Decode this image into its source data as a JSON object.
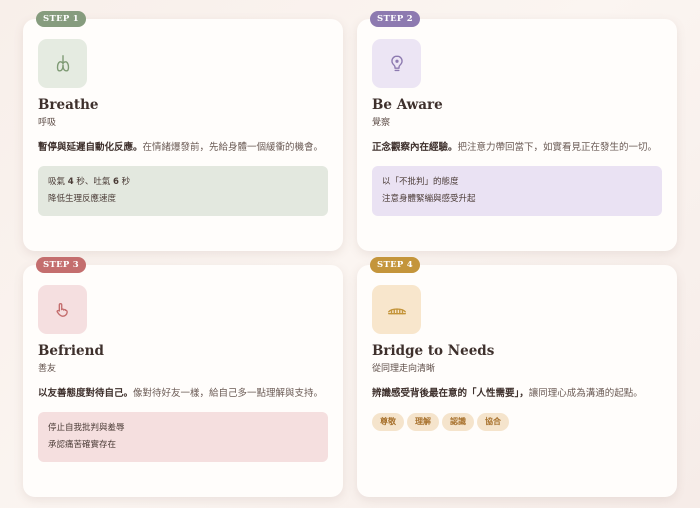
{
  "colors": {
    "step1": "#869c7e",
    "step2": "#8d7ab0",
    "step3": "#c46e6e",
    "step4": "#c4953b",
    "icon1_bg": "#e5ebe1",
    "icon2_bg": "#ece5f4",
    "icon3_bg": "#f5dfe0",
    "icon4_bg": "#f8e6cc",
    "note1_bg": "#e3e8df",
    "note2_bg": "#eae2f3",
    "note3_bg": "#f5dfdf"
  },
  "cards": [
    {
      "step": "STEP 1",
      "icon": "lungs-icon",
      "title": "Breathe",
      "subtitle": "呼吸",
      "desc_strong": "暫停與延遲自動化反應。",
      "desc_rest": "在情緒爆發前，先給身體一個緩衝的機會。",
      "note_line1_a": "吸氣 ",
      "note_line1_b": "4",
      "note_line1_c": " 秒、吐氣 ",
      "note_line1_d": "6",
      "note_line1_e": " 秒",
      "note_line2": "降低生理反應速度"
    },
    {
      "step": "STEP 2",
      "icon": "lightbulb-icon",
      "title": "Be Aware",
      "subtitle": "覺察",
      "desc_strong": "正念觀察內在經驗。",
      "desc_rest": "把注意力帶回當下，如實看見正在發生的一切。",
      "note_line1": "以「不批判」的態度",
      "note_line2": "注意身體緊繃與感受升起"
    },
    {
      "step": "STEP 3",
      "icon": "hand-heart-icon",
      "title": "Befriend",
      "subtitle": "善友",
      "desc_strong": "以友善態度對待自己。",
      "desc_rest": "像對待好友一樣，給自己多一點理解與支持。",
      "note_line1": "停止自我批判與羞辱",
      "note_line2": "承認痛苦確實存在"
    },
    {
      "step": "STEP 4",
      "icon": "bridge-icon",
      "title": "Bridge to Needs",
      "subtitle": "從同理走向清晰",
      "desc_strong": "辨識感受背後最在意的「人性需要」，",
      "desc_rest": "讓同理心成為溝通的起點。",
      "tags": [
        "尊敬",
        "理解",
        "認識",
        "協合"
      ]
    }
  ]
}
